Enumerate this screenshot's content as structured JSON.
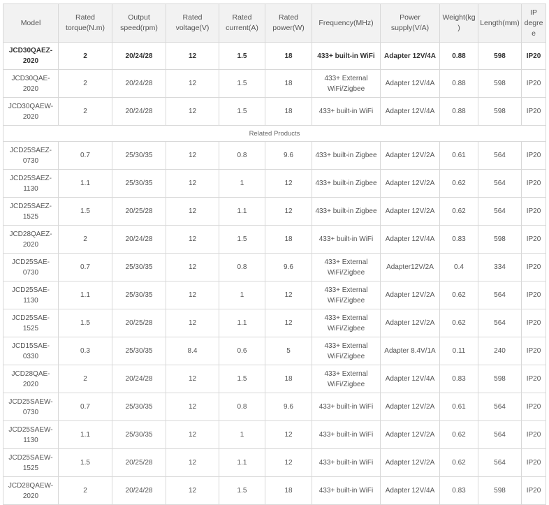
{
  "headers": [
    "Model",
    "Rated torque(N.m)",
    "Output speed(rpm)",
    "Rated voltage(V)",
    "Rated current(A)",
    "Rated power(W)",
    "Frequency(MHz)",
    "Power supply(V/A)",
    "Weight(kg)",
    "Length(mm)",
    "IP degree"
  ],
  "featured": [
    {
      "model": "JCD30QAEZ-2020",
      "torque": "2",
      "speed": "20/24/28",
      "voltage": "12",
      "current": "1.5",
      "power": "18",
      "freq": "433+ built-in WiFi",
      "supply": "Adapter 12V/4A",
      "weight": "0.88",
      "length": "598",
      "ip": "IP20"
    }
  ],
  "rows_top": [
    {
      "model": "JCD30QAE-2020",
      "torque": "2",
      "speed": "20/24/28",
      "voltage": "12",
      "current": "1.5",
      "power": "18",
      "freq": "433+ External WiFi/Zigbee",
      "supply": "Adapter 12V/4A",
      "weight": "0.88",
      "length": "598",
      "ip": "IP20"
    },
    {
      "model": "JCD30QAEW-2020",
      "torque": "2",
      "speed": "20/24/28",
      "voltage": "12",
      "current": "1.5",
      "power": "18",
      "freq": "433+ built-in WiFi",
      "supply": "Adapter 12V/4A",
      "weight": "0.88",
      "length": "598",
      "ip": "IP20"
    }
  ],
  "section_label": "Related Products",
  "related": [
    {
      "model": "JCD25SAEZ-0730",
      "torque": "0.7",
      "speed": "25/30/35",
      "voltage": "12",
      "current": "0.8",
      "power": "9.6",
      "freq": "433+ built-in Zigbee",
      "supply": "Adapter 12V/2A",
      "weight": "0.61",
      "length": "564",
      "ip": "IP20"
    },
    {
      "model": "JCD25SAEZ-1130",
      "torque": "1.1",
      "speed": "25/30/35",
      "voltage": "12",
      "current": "1",
      "power": "12",
      "freq": "433+ built-in Zigbee",
      "supply": "Adapter 12V/2A",
      "weight": "0.62",
      "length": "564",
      "ip": "IP20"
    },
    {
      "model": "JCD25SAEZ-1525",
      "torque": "1.5",
      "speed": "20/25/28",
      "voltage": "12",
      "current": "1.1",
      "power": "12",
      "freq": "433+ built-in Zigbee",
      "supply": "Adapter 12V/2A",
      "weight": "0.62",
      "length": "564",
      "ip": "IP20"
    },
    {
      "model": "JCD28QAEZ-2020",
      "torque": "2",
      "speed": "20/24/28",
      "voltage": "12",
      "current": "1.5",
      "power": "18",
      "freq": "433+ built-in WiFi",
      "supply": "Adapter 12V/4A",
      "weight": "0.83",
      "length": "598",
      "ip": "IP20"
    },
    {
      "model": "JCD25SAE-0730",
      "torque": "0.7",
      "speed": "25/30/35",
      "voltage": "12",
      "current": "0.8",
      "power": "9.6",
      "freq": "433+ External WiFi/Zigbee",
      "supply": "Adapter12V/2A",
      "weight": "0.4",
      "length": "334",
      "ip": "IP20"
    },
    {
      "model": "JCD25SAE-1130",
      "torque": "1.1",
      "speed": "25/30/35",
      "voltage": "12",
      "current": "1",
      "power": "12",
      "freq": "433+ External WiFi/Zigbee",
      "supply": "Adapter 12V/2A",
      "weight": "0.62",
      "length": "564",
      "ip": "IP20"
    },
    {
      "model": "JCD25SAE-1525",
      "torque": "1.5",
      "speed": "20/25/28",
      "voltage": "12",
      "current": "1.1",
      "power": "12",
      "freq": "433+ External WiFi/Zigbee",
      "supply": "Adapter 12V/2A",
      "weight": "0.62",
      "length": "564",
      "ip": "IP20"
    },
    {
      "model": "JCD15SAE-0330",
      "torque": "0.3",
      "speed": "25/30/35",
      "voltage": "8.4",
      "current": "0.6",
      "power": "5",
      "freq": "433+ External WiFi/Zigbee",
      "supply": "Adapter 8.4V/1A",
      "weight": "0.11",
      "length": "240",
      "ip": "IP20"
    },
    {
      "model": "JCD28QAE-2020",
      "torque": "2",
      "speed": "20/24/28",
      "voltage": "12",
      "current": "1.5",
      "power": "18",
      "freq": "433+ External WiFi/Zigbee",
      "supply": "Adapter 12V/4A",
      "weight": "0.83",
      "length": "598",
      "ip": "IP20"
    },
    {
      "model": "JCD25SAEW-0730",
      "torque": "0.7",
      "speed": "25/30/35",
      "voltage": "12",
      "current": "0.8",
      "power": "9.6",
      "freq": "433+ built-in WiFi",
      "supply": "Adapter 12V/2A",
      "weight": "0.61",
      "length": "564",
      "ip": "IP20"
    },
    {
      "model": "JCD25SAEW-1130",
      "torque": "1.1",
      "speed": "25/30/35",
      "voltage": "12",
      "current": "1",
      "power": "12",
      "freq": "433+ built-in WiFi",
      "supply": "Adapter 12V/2A",
      "weight": "0.62",
      "length": "564",
      "ip": "IP20"
    },
    {
      "model": "JCD25SAEW-1525",
      "torque": "1.5",
      "speed": "20/25/28",
      "voltage": "12",
      "current": "1.1",
      "power": "12",
      "freq": "433+ built-in WiFi",
      "supply": "Adapter 12V/2A",
      "weight": "0.62",
      "length": "564",
      "ip": "IP20"
    },
    {
      "model": "JCD28QAEW-2020",
      "torque": "2",
      "speed": "20/24/28",
      "voltage": "12",
      "current": "1.5",
      "power": "18",
      "freq": "433+ built-in WiFi",
      "supply": "Adapter 12V/4A",
      "weight": "0.83",
      "length": "598",
      "ip": "IP20"
    }
  ]
}
